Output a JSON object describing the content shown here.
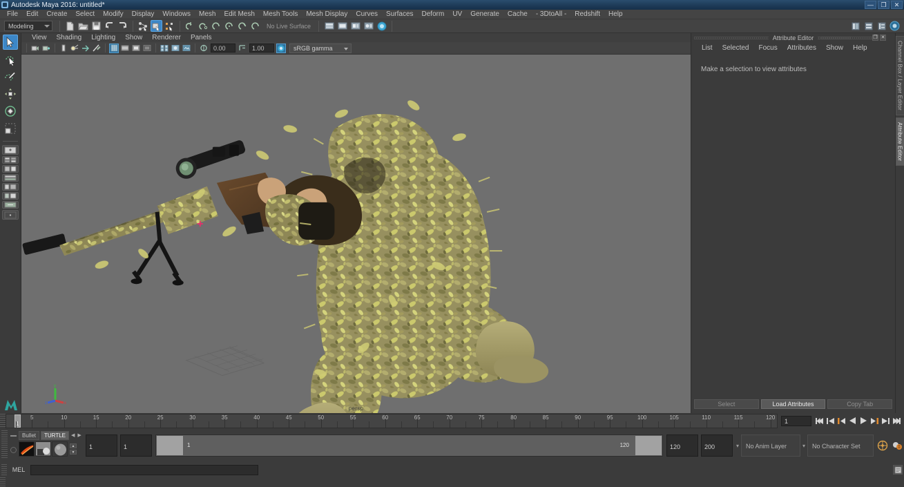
{
  "window": {
    "title": "Autodesk Maya 2016: untitled*",
    "app_icon": "maya-icon",
    "controls": [
      {
        "name": "minimize-button",
        "glyph": "—"
      },
      {
        "name": "maximize-button",
        "glyph": "❐"
      },
      {
        "name": "close-button",
        "glyph": "✕"
      }
    ]
  },
  "menubar": {
    "items": [
      "File",
      "Edit",
      "Create",
      "Select",
      "Modify",
      "Display",
      "Windows",
      "Mesh",
      "Edit Mesh",
      "Mesh Tools",
      "Mesh Display",
      "Curves",
      "Surfaces",
      "Deform",
      "UV",
      "Generate",
      "Cache",
      "- 3DtoAll -",
      "Redshift",
      "Help"
    ]
  },
  "toolbar": {
    "menu_set": "Modeling",
    "no_live_surface": "No Live Surface",
    "icons": [
      "new-scene-icon",
      "open-scene-icon",
      "save-scene-icon",
      "undo-icon",
      "redo-icon",
      "select-by-hierarchy-icon",
      "select-by-object-icon",
      "select-by-component-icon",
      "snap-to-grid-icon",
      "snap-to-curve-icon",
      "snap-to-point-icon",
      "snap-to-projected-center-icon",
      "snap-to-view-plane-icon",
      "make-live-icon",
      "render-current-frame-icon",
      "ipr-render-icon",
      "render-settings-icon",
      "hypershade-icon",
      "render-view-icon",
      "show-hide-channel-box-icon",
      "show-hide-layer-editor-icon",
      "show-hide-attribute-editor-icon",
      "show-hide-tool-settings-icon"
    ]
  },
  "toolbox": {
    "tools": [
      {
        "name": "select-tool",
        "selected": true
      },
      {
        "name": "lasso-select-tool",
        "selected": false
      },
      {
        "name": "paint-select-tool",
        "selected": false
      },
      {
        "name": "move-tool",
        "selected": false
      },
      {
        "name": "rotate-tool",
        "selected": false
      },
      {
        "name": "scale-tool",
        "selected": false
      }
    ],
    "layouts": [
      "single-perspective-layout",
      "four-view-layout",
      "two-panes-side-layout",
      "two-panes-stacked-layout",
      "three-panes-layout",
      "outliner-persp-layout",
      "hypershade-persp-layout",
      "persp-graph-layout"
    ]
  },
  "viewport": {
    "menus": [
      "View",
      "Shading",
      "Lighting",
      "Show",
      "Renderer",
      "Panels"
    ],
    "exposure_value": "0.00",
    "gamma_value": "1.00",
    "color_management": "sRGB gamma",
    "camera_label": "persp",
    "background_color": "#6f6f6f",
    "axis": {
      "x": "x",
      "y": "y",
      "z": "z",
      "x_color": "#d04040",
      "y_color": "#3fbb3f",
      "z_color": "#4060cf"
    },
    "model_description": "Camouflaged sniper in ghillie suit kneeling with scoped rifle",
    "icons": [
      "camera-attributes-icon",
      "two-sided-lighting-icon",
      "shadows-icon",
      "light-icon",
      "multi-color-feedback-icon",
      "xray-icon",
      "grid-icon",
      "film-gate-icon",
      "resolution-gate-icon",
      "gate-mask-icon",
      "wireframe-on-shaded-icon",
      "smooth-shade-icon",
      "textured-icon",
      "exposure-icon",
      "gamma-icon",
      "color-management-icon"
    ]
  },
  "attribute_editor": {
    "panel_title": "Attribute Editor",
    "menus": [
      "List",
      "Selected",
      "Focus",
      "Attributes",
      "Show",
      "Help"
    ],
    "empty_hint": "Make a selection to view attributes",
    "footer_buttons": [
      {
        "label": "Select",
        "enabled": false
      },
      {
        "label": "Load Attributes",
        "enabled": true
      },
      {
        "label": "Copy Tab",
        "enabled": false
      }
    ],
    "window_buttons": [
      {
        "name": "undock-button",
        "glyph": "❐"
      },
      {
        "name": "close-panel-button",
        "glyph": "✕"
      }
    ]
  },
  "side_tabs": [
    {
      "label": "Channel Box / Layer Editor",
      "selected": false
    },
    {
      "label": "Attribute Editor",
      "selected": true
    }
  ],
  "time_slider": {
    "start": 1,
    "end": 120,
    "current_frame": "1",
    "tick_labels": [
      5,
      10,
      15,
      20,
      25,
      30,
      35,
      40,
      45,
      50,
      55,
      60,
      65,
      70,
      75,
      80,
      85,
      90,
      95,
      100,
      105,
      110,
      115,
      120
    ],
    "frame_field": "1",
    "playback_buttons": [
      "go-to-start-icon",
      "step-back-keyframe-icon",
      "step-back-frame-icon",
      "play-backwards-icon",
      "play-forwards-icon",
      "step-forward-frame-icon",
      "step-forward-keyframe-icon",
      "go-to-end-icon"
    ]
  },
  "range_slider": {
    "anim_start": "1",
    "anim_end": "1",
    "range_start_label": "1",
    "range_end_label": "120",
    "playback_end": "120",
    "anim_total_end": "200",
    "anim_layer": "No Anim Layer",
    "character_set": "No Character Set",
    "buttons": [
      "auto-keyframe-icon",
      "animation-preferences-icon"
    ]
  },
  "shelf": {
    "tabs": [
      {
        "label": "Bullet",
        "selected": false
      },
      {
        "label": "TURTLE",
        "selected": true
      }
    ],
    "nav": [
      "shelf-prev-icon",
      "shelf-next-icon"
    ],
    "items": [
      "turtle-bake-icon",
      "turtle-render-icon",
      "turtle-material-icon"
    ]
  },
  "command_line": {
    "language_label": "MEL",
    "input_value": "",
    "placeholder": "",
    "buttons": [
      "script-editor-icon"
    ]
  },
  "status_bar": {
    "message": ""
  },
  "colors": {
    "accent_blue": "#3c87c7",
    "titlebar": "#1d3a56",
    "panel_bg": "#3b3b3b",
    "viewport_bg": "#6f6f6f",
    "field_bg": "#2c2c2c"
  }
}
